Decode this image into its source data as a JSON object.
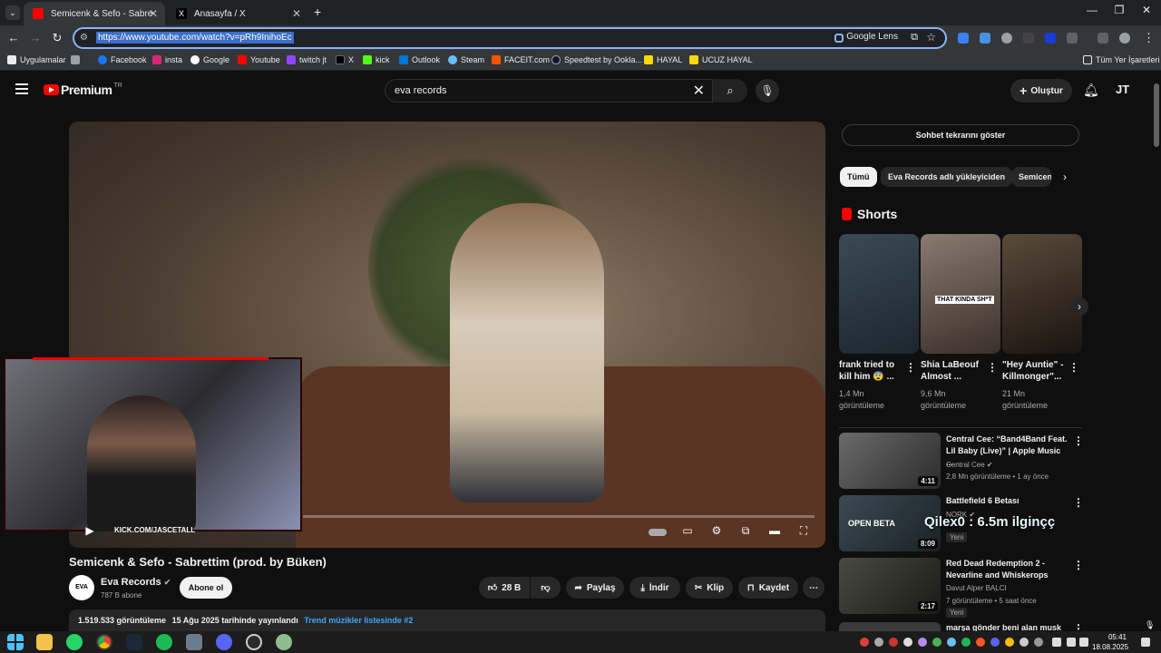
{
  "browser": {
    "tabs": [
      {
        "title": "Semicenk & Sefo - Sabrettim (p",
        "active": true
      },
      {
        "title": "Anasayfa / X",
        "active": false
      }
    ],
    "url": "https://www.youtube.com/watch?v=pRh9InihoEc",
    "lens_label": "Google Lens",
    "bookmarks": [
      "Uygulamalar",
      "Facebook",
      "insta",
      "Google",
      "Youtube",
      "twitch jt",
      "X",
      "kick",
      "Outlook",
      "Steam",
      "FACEIT.com",
      "Speedtest by Ookla...",
      "HAYAL",
      "UCUZ HAYAL"
    ],
    "all_bookmarks": "Tüm Yer İşaretleri"
  },
  "youtube": {
    "logo": "Premium",
    "logo_region": "TR",
    "search_value": "eva records",
    "create_label": "Oluştur",
    "avatar": "JT"
  },
  "video": {
    "title": "Semicenk & Sefo - Sabrettim (prod. by Büken)",
    "channel": "Eva Records",
    "channel_avatar": "EVA",
    "subscribers": "787 B abone",
    "subscribe_label": "Abone ol",
    "likes": "28 B",
    "share_label": "Paylaş",
    "download_label": "İndir",
    "clip_label": "Klip",
    "save_label": "Kaydet",
    "views": "1.519.533 görüntüleme",
    "date": "15 Ağu 2025 tarihinde yayınlandı",
    "trend": "Trend müzikler listesinde #2",
    "cam_watermark": "KICK.COM/JASCETALL"
  },
  "sidebar": {
    "chat_button": "Sohbet tekrarını göster",
    "chips": [
      "Tümü",
      "Eva Records adlı yükleyiciden",
      "Semicen"
    ],
    "shorts_heading": "Shorts",
    "shorts": [
      {
        "title": "frank tried to kill him 😨 ...",
        "views": "1,4 Mn görüntüleme"
      },
      {
        "title": "Shia LaBeouf Almost ...",
        "views": "9,6 Mn görüntüleme",
        "overlay": "THAT KINDA SH*T"
      },
      {
        "title": "\"Hey Auntie\" - Killmonger\"...",
        "views": "21 Mn görüntüleme"
      }
    ],
    "recommendations": [
      {
        "title": "Central Cee: “Band4Band Feat. Lil Baby (Live)” | Apple Music ...",
        "channel": "Central Cee",
        "meta": "2,8 Mn görüntüleme • 1 ay önce",
        "duration": "4:11",
        "badge": ""
      },
      {
        "title": "Battlefield 6 Betası",
        "channel": "NORK",
        "meta": "",
        "duration": "8:09",
        "badge": "Yeni",
        "overlay": "Qilex0 : 6.5m ilginçç",
        "thumb_text": "OPEN BETA"
      },
      {
        "title": "Red Dead Redemption 2 - Nevarline and Whiskerops",
        "channel": "Davut Alper BALCI",
        "meta": "7 görüntüleme • 5 saat önce",
        "duration": "2:17",
        "badge": "Yeni"
      },
      {
        "title": "marşa gönder beni alan musk",
        "channel": "",
        "meta": "",
        "duration": "",
        "badge": ""
      }
    ]
  },
  "taskbar": {
    "time": "05:41",
    "date": "18.08.2025"
  },
  "colors": {
    "youtube_red": "#ff0000",
    "link_blue": "#3ea6ff",
    "chrome_accent": "#8ab4f8"
  }
}
